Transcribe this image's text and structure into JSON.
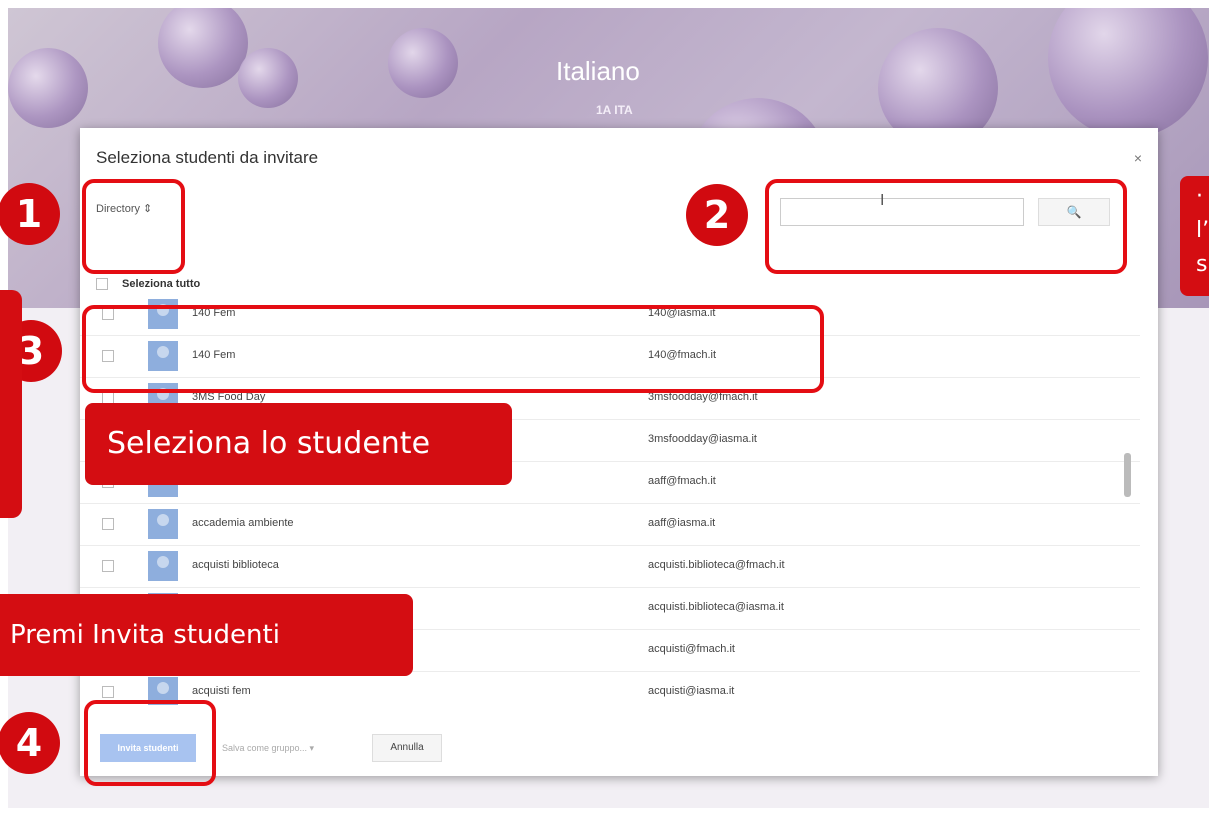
{
  "course": {
    "title": "Italiano",
    "section": "1A ITA"
  },
  "dialog": {
    "title": "Seleziona studenti da invitare",
    "close": "×",
    "directory_select": "Directory ⇕",
    "search_cursor": "I",
    "search_icon": "🔍",
    "select_all": "Seleziona tutto",
    "students": [
      {
        "name": "140 Fem",
        "email": "140@iasma.it"
      },
      {
        "name": "140 Fem",
        "email": "140@fmach.it"
      },
      {
        "name": "3MS Food Day",
        "email": "3msfoodday@fmach.it"
      },
      {
        "name": "",
        "email": "3msfoodday@iasma.it"
      },
      {
        "name": "",
        "email": "aaff@fmach.it"
      },
      {
        "name": "accademia ambiente",
        "email": "aaff@iasma.it"
      },
      {
        "name": "acquisti biblioteca",
        "email": "acquisti.biblioteca@fmach.it"
      },
      {
        "name": "",
        "email": "acquisti.biblioteca@iasma.it"
      },
      {
        "name": "",
        "email": "acquisti@fmach.it"
      },
      {
        "name": "acquisti fem",
        "email": "acquisti@iasma.it"
      }
    ],
    "invite_button": "Invita studenti",
    "group_button": "Salva come gruppo... ▾",
    "cancel_button": "Annulla"
  },
  "annotations": {
    "n1": "1",
    "n2": "2",
    "n3": "3",
    "n4": "4",
    "callout_select": "Seleziona lo studente",
    "callout_invite": "Premi Invita studenti",
    "callout_right_line1": "·",
    "callout_right_line2": "l’",
    "callout_right_line3": "s"
  },
  "colors": {
    "annotation_red": "#d40d12",
    "invite_button": "#a8c3f0"
  }
}
